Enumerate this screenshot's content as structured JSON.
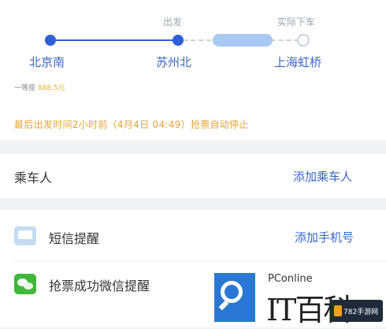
{
  "route": {
    "depart_tag": "出发",
    "arrive_tag": "实际下车",
    "pill_label": "",
    "stations": [
      "北京南",
      "苏州北",
      "上海虹桥"
    ],
    "seat_prefix": "一等座",
    "seat_value": "888.5元",
    "deadline_text": "最后出发时间2小时前（4月4日 04:49）抢票自动停止"
  },
  "passenger": {
    "label": "乘车人",
    "add_label": "添加乘车人"
  },
  "notify": {
    "sms_label": "短信提醒",
    "sms_action": "添加手机号",
    "wechat_label": "抢票成功微信提醒"
  },
  "watermark": {
    "brand": "PConline",
    "letters": "IT百科",
    "badge": "782手游网"
  },
  "colors": {
    "accent": "#2f5fd6",
    "link": "#3a66c4",
    "warning": "#e8a33a",
    "background": "#f2f3f5",
    "wechat": "#3fb73b"
  }
}
